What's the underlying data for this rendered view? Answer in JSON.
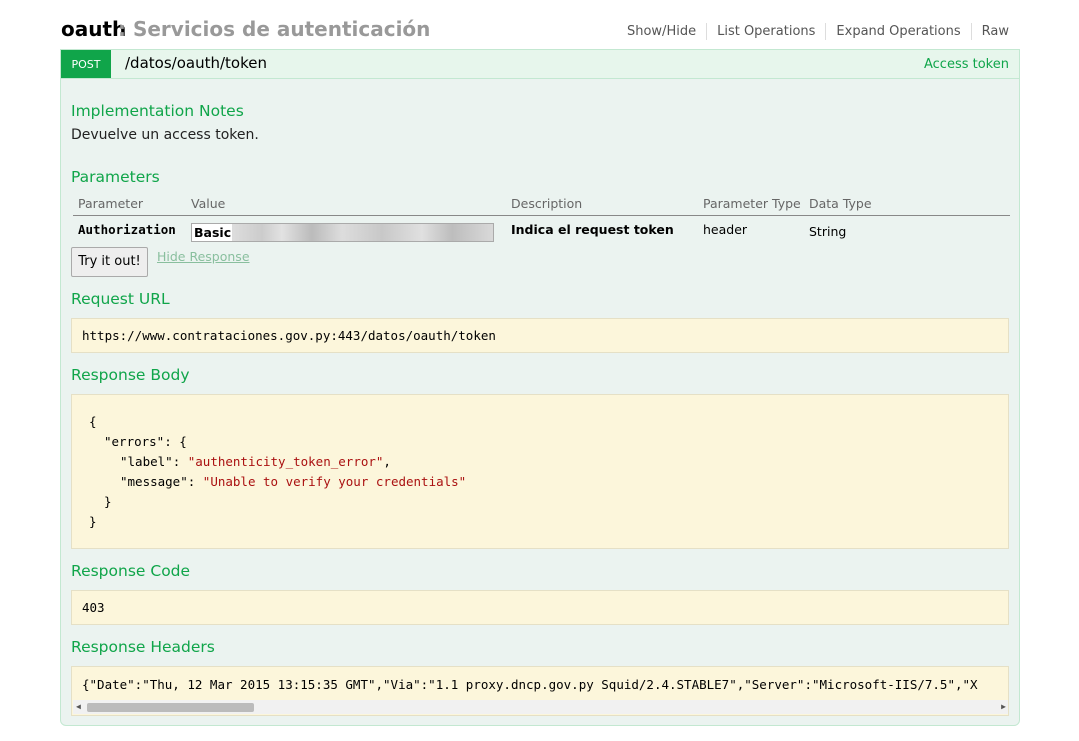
{
  "resource": {
    "name": "oauth",
    "description": ": Servicios de autenticación",
    "options": [
      "Show/Hide",
      "List Operations",
      "Expand Operations",
      "Raw"
    ]
  },
  "operation": {
    "method": "POST",
    "path": "/datos/oauth/token",
    "summary": "Access token",
    "implementation_notes_title": "Implementation Notes",
    "implementation_notes": "Devuelve un access token.",
    "parameters_title": "Parameters",
    "param_headers": {
      "parameter": "Parameter",
      "value": "Value",
      "description": "Description",
      "parameter_type": "Parameter Type",
      "data_type": "Data Type"
    },
    "params": [
      {
        "name": "Authorization",
        "value": "Basic",
        "description": "Indica el request token",
        "parameter_type": "header",
        "data_type": "String"
      }
    ],
    "try_button": "Try it out!",
    "hide_response": "Hide Response",
    "request_url_title": "Request URL",
    "request_url": "https://www.contrataciones.gov.py:443/datos/oauth/token",
    "response_body_title": "Response Body",
    "response_body": {
      "l1": "{",
      "l2_key": "\"errors\"",
      "l2_rest": ": {",
      "l3_key": "\"label\"",
      "l3_val": "\"authenticity_token_error\"",
      "l3_end": ",",
      "l4_key": "\"message\"",
      "l4_val": "\"Unable to verify your credentials\"",
      "l5": "}",
      "l6": "}"
    },
    "response_code_title": "Response Code",
    "response_code": "403",
    "response_headers_title": "Response Headers",
    "response_headers": "{\"Date\":\"Thu, 12 Mar 2015 13:15:35 GMT\",\"Via\":\"1.1 proxy.dncp.gov.py Squid/2.4.STABLE7\",\"Server\":\"Microsoft-IIS/7.5\",\"X"
  }
}
